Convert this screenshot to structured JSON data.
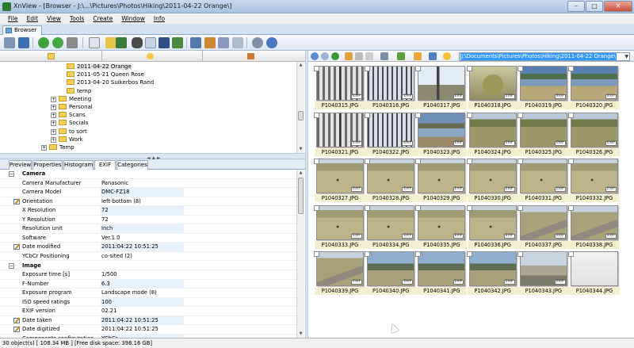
{
  "window": {
    "title": "XnView - [Browser - J:\\...\\Pictures\\Photos\\Hiking\\2011-04-22 Orange\\]",
    "min": "–",
    "max": "□",
    "close": "✕"
  },
  "menu": [
    "File",
    "Edit",
    "View",
    "Tools",
    "Create",
    "Window",
    "Info"
  ],
  "tabs": {
    "browser": "Browser"
  },
  "tree": [
    {
      "label": "2011-04-22 Orange",
      "indent": 3,
      "selected": true
    },
    {
      "label": "2011-05-21 Queen Rose",
      "indent": 3
    },
    {
      "label": "2013-04-20 Suikerbos Rand",
      "indent": 3
    },
    {
      "label": "temp",
      "indent": 3
    },
    {
      "label": "Meeting",
      "indent": 2,
      "exp": "+"
    },
    {
      "label": "Personal",
      "indent": 2,
      "exp": "+"
    },
    {
      "label": "Scans",
      "indent": 2,
      "exp": "+"
    },
    {
      "label": "Socials",
      "indent": 2,
      "exp": "+"
    },
    {
      "label": "to sort",
      "indent": 2,
      "exp": "+"
    },
    {
      "label": "Work",
      "indent": 2,
      "exp": "+"
    },
    {
      "label": "Temp",
      "indent": 1,
      "exp": "+"
    }
  ],
  "prop_tabs": [
    "Preview",
    "Properties",
    "Histogram",
    "EXIF",
    "Categories"
  ],
  "exif": [
    {
      "section": true,
      "key": "Camera"
    },
    {
      "key": "Camera Manufacturer",
      "value": "Panasonic"
    },
    {
      "key": "Camera Model",
      "value": "DMC-FZ18"
    },
    {
      "key": "Orientation",
      "value": "left-bottom (8)",
      "mod": true
    },
    {
      "key": "X Resolution",
      "value": "72"
    },
    {
      "key": "Y Resolution",
      "value": "72"
    },
    {
      "key": "Resolution unit",
      "value": "Inch"
    },
    {
      "key": "Software",
      "value": "Ver.1.0"
    },
    {
      "key": "Date modified",
      "value": "2011:04:22 10:51:25",
      "mod": true
    },
    {
      "key": "YCbCr Positioning",
      "value": "co-sited (2)"
    },
    {
      "section": true,
      "key": "Image"
    },
    {
      "key": "Exposure time [s]",
      "value": "1/500"
    },
    {
      "key": "F-Number",
      "value": "6.3"
    },
    {
      "key": "Exposure program",
      "value": "Landscape mode (8)"
    },
    {
      "key": "ISO speed ratings",
      "value": "100"
    },
    {
      "key": "EXIF version",
      "value": "02.21"
    },
    {
      "key": "Date taken",
      "value": "2011:04:22 10:51:25",
      "mod": true
    },
    {
      "key": "Date digitized",
      "value": "2011:04:22 10:51:25",
      "mod": true
    },
    {
      "key": "Components configuration",
      "value": "YCbCr"
    }
  ],
  "path": "J:\\Documents\\Pictures\\Photos\\Hiking\\2011-04-22 Orange\\",
  "exif_badge": "EXIF",
  "thumbnails": [
    {
      "name": "P1040315.JPG",
      "scene": "fence"
    },
    {
      "name": "P1040316.JPG",
      "scene": "bridge"
    },
    {
      "name": "P1040317.JPG",
      "scene": "pole"
    },
    {
      "name": "P1040318.JPG",
      "scene": "bush"
    },
    {
      "name": "P1040319.JPG",
      "scene": "lake"
    },
    {
      "name": "P1040320.JPG",
      "scene": "lake"
    },
    {
      "name": "P1040321.JPG",
      "scene": "fence"
    },
    {
      "name": "P1040322.JPG",
      "scene": "bridge"
    },
    {
      "name": "P1040323.JPG",
      "scene": "river"
    },
    {
      "name": "P1040324.JPG",
      "scene": "field"
    },
    {
      "name": "P1040325.JPG",
      "scene": "field"
    },
    {
      "name": "P1040326.JPG",
      "scene": "field"
    },
    {
      "name": "P1040327.JPG",
      "scene": "dry"
    },
    {
      "name": "P1040328.JPG",
      "scene": "dry"
    },
    {
      "name": "P1040329.JPG",
      "scene": "dry"
    },
    {
      "name": "P1040330.JPG",
      "scene": "dry"
    },
    {
      "name": "P1040331.JPG",
      "scene": "dry"
    },
    {
      "name": "P1040332.JPG",
      "scene": "dry"
    },
    {
      "name": "P1040333.JPG",
      "scene": "dry"
    },
    {
      "name": "P1040334.JPG",
      "scene": "dry"
    },
    {
      "name": "P1040335.JPG",
      "scene": "dry"
    },
    {
      "name": "P1040336.JPG",
      "scene": "dry"
    },
    {
      "name": "P1040337.JPG",
      "scene": "road"
    },
    {
      "name": "P1040338.JPG",
      "scene": "road"
    },
    {
      "name": "P1040339.JPG",
      "scene": "road"
    },
    {
      "name": "P1040340.JPG",
      "scene": "hills"
    },
    {
      "name": "P1040341.JPG",
      "scene": "hills"
    },
    {
      "name": "P1040342.JPG",
      "scene": "hills"
    },
    {
      "name": "P1040343.JPG",
      "scene": "car"
    },
    {
      "name": "P1040344.JPG",
      "scene": "blank"
    }
  ],
  "status": "30 object(s) [ 108.34 MB ] [Free disk space: 398.16 GB]",
  "colors": {
    "accent": "#3399ff",
    "label_bg": "#f1f1d0",
    "chrome": "#d9e4f1"
  }
}
